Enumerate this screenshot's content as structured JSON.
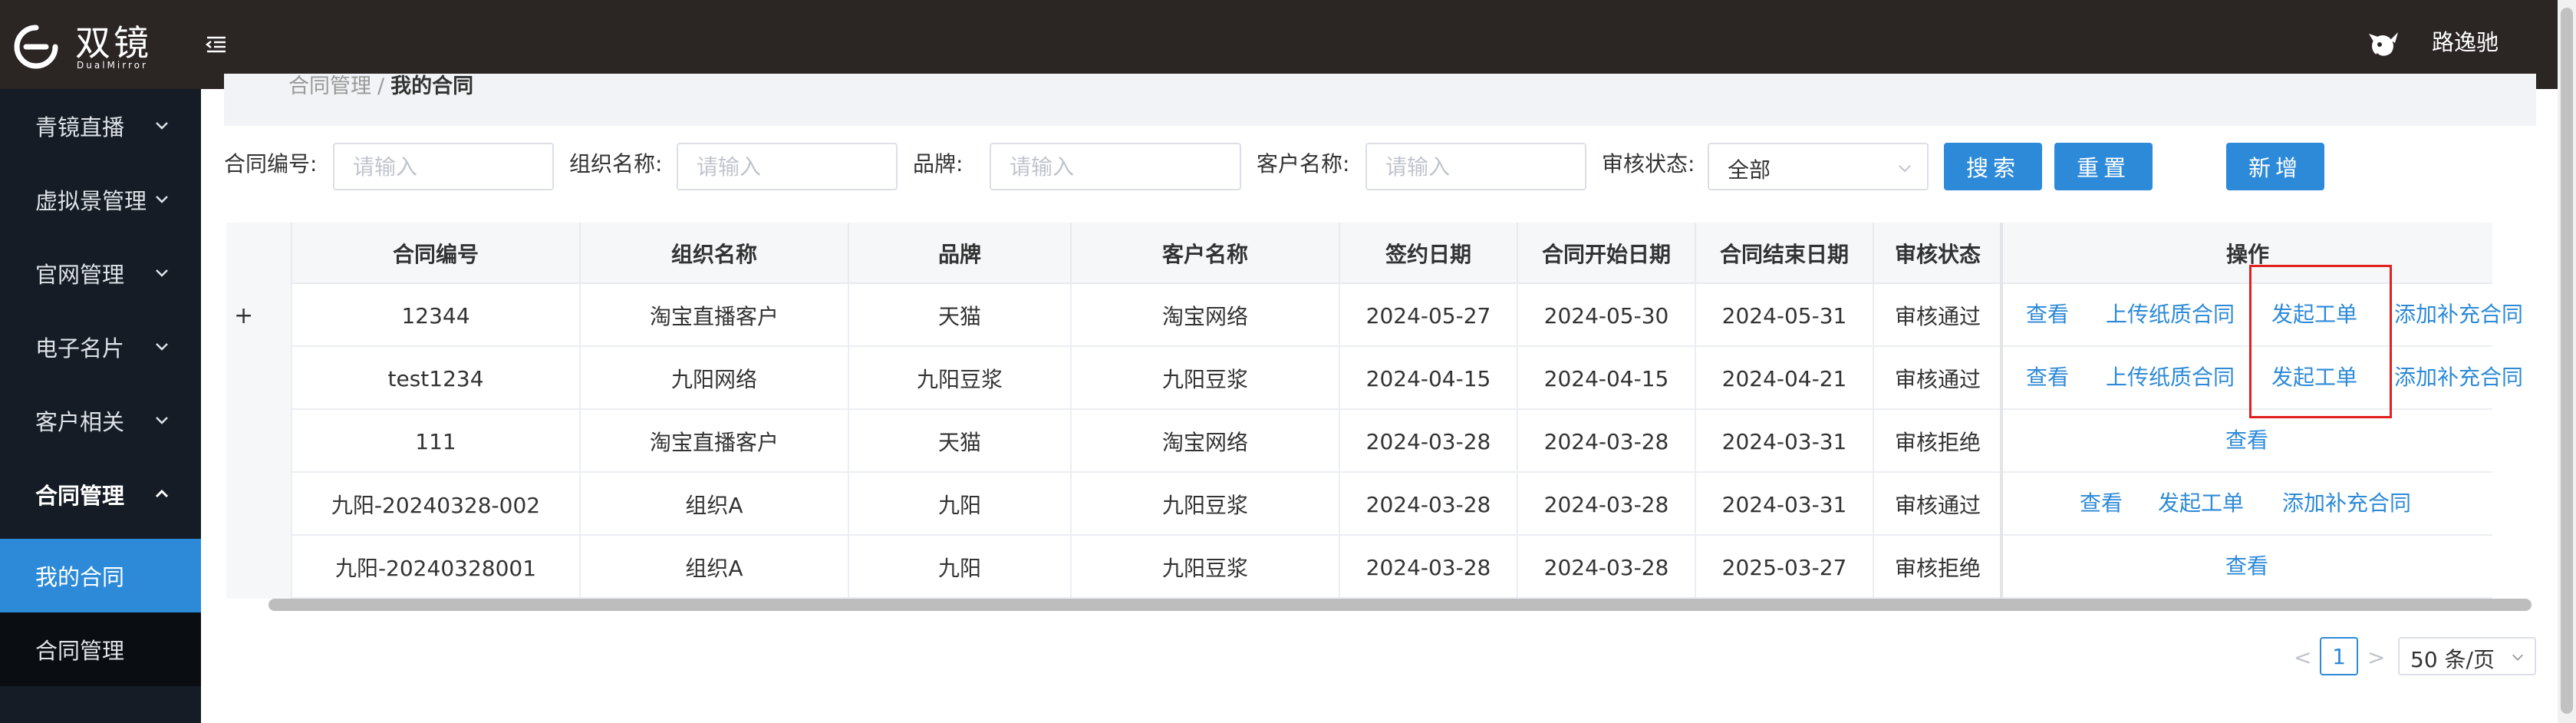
{
  "header": {
    "logo_text": "双镜",
    "logo_sub": "DualMirror",
    "user_name": "路逸驰"
  },
  "sidebar": {
    "items": [
      {
        "label": "青镜直播"
      },
      {
        "label": "虚拟景管理"
      },
      {
        "label": "官网管理"
      },
      {
        "label": "电子名片"
      },
      {
        "label": "客户相关"
      },
      {
        "label": "合同管理"
      }
    ],
    "sub_items": [
      {
        "label": "我的合同"
      },
      {
        "label": "合同管理"
      }
    ]
  },
  "breadcrumb": {
    "parent": "合同管理",
    "separator": "/",
    "current": "我的合同"
  },
  "filters": {
    "contract_no_label": "合同编号:",
    "org_label": "组织名称:",
    "brand_label": "品牌:",
    "customer_label": "客户名称:",
    "status_label": "审核状态:",
    "placeholder": "请输入",
    "status_value": "全部",
    "search_button": "搜索",
    "reset_button": "重置",
    "add_button": "新增"
  },
  "table": {
    "columns": [
      "合同编号",
      "组织名称",
      "品牌",
      "客户名称",
      "签约日期",
      "合同开始日期",
      "合同结束日期",
      "审核状态",
      "操作"
    ],
    "rows": [
      {
        "expand": "+",
        "no": "12344",
        "org": "淘宝直播客户",
        "brand": "天猫",
        "customer": "淘宝网络",
        "sign": "2024-05-27",
        "start": "2024-05-30",
        "end": "2024-05-31",
        "status": "审核通过",
        "ops": [
          "查看",
          "上传纸质合同",
          "发起工单",
          "添加补充合同"
        ]
      },
      {
        "expand": "",
        "no": "test1234",
        "org": "九阳网络",
        "brand": "九阳豆浆",
        "customer": "九阳豆浆",
        "sign": "2024-04-15",
        "start": "2024-04-15",
        "end": "2024-04-21",
        "status": "审核通过",
        "ops": [
          "查看",
          "上传纸质合同",
          "发起工单",
          "添加补充合同"
        ]
      },
      {
        "expand": "",
        "no": "111",
        "org": "淘宝直播客户",
        "brand": "天猫",
        "customer": "淘宝网络",
        "sign": "2024-03-28",
        "start": "2024-03-28",
        "end": "2024-03-31",
        "status": "审核拒绝",
        "ops": [
          "查看"
        ]
      },
      {
        "expand": "",
        "no": "九阳-20240328-002",
        "org": "组织A",
        "brand": "九阳",
        "customer": "九阳豆浆",
        "sign": "2024-03-28",
        "start": "2024-03-28",
        "end": "2024-03-31",
        "status": "审核通过",
        "ops": [
          "查看",
          "发起工单",
          "添加补充合同"
        ]
      },
      {
        "expand": "",
        "no": "九阳-20240328001",
        "org": "组织A",
        "brand": "九阳",
        "customer": "九阳豆浆",
        "sign": "2024-03-28",
        "start": "2024-03-28",
        "end": "2025-03-27",
        "status": "审核拒绝",
        "ops": [
          "查看"
        ]
      }
    ]
  },
  "pagination": {
    "prev": "<",
    "current_page": "1",
    "next": ">",
    "page_size": "50 条/页"
  },
  "colors": {
    "header_bg": "#2b2524",
    "sidebar_bg": "#151c25",
    "accent": "#2d8ad8",
    "highlight": "#e0211f"
  }
}
